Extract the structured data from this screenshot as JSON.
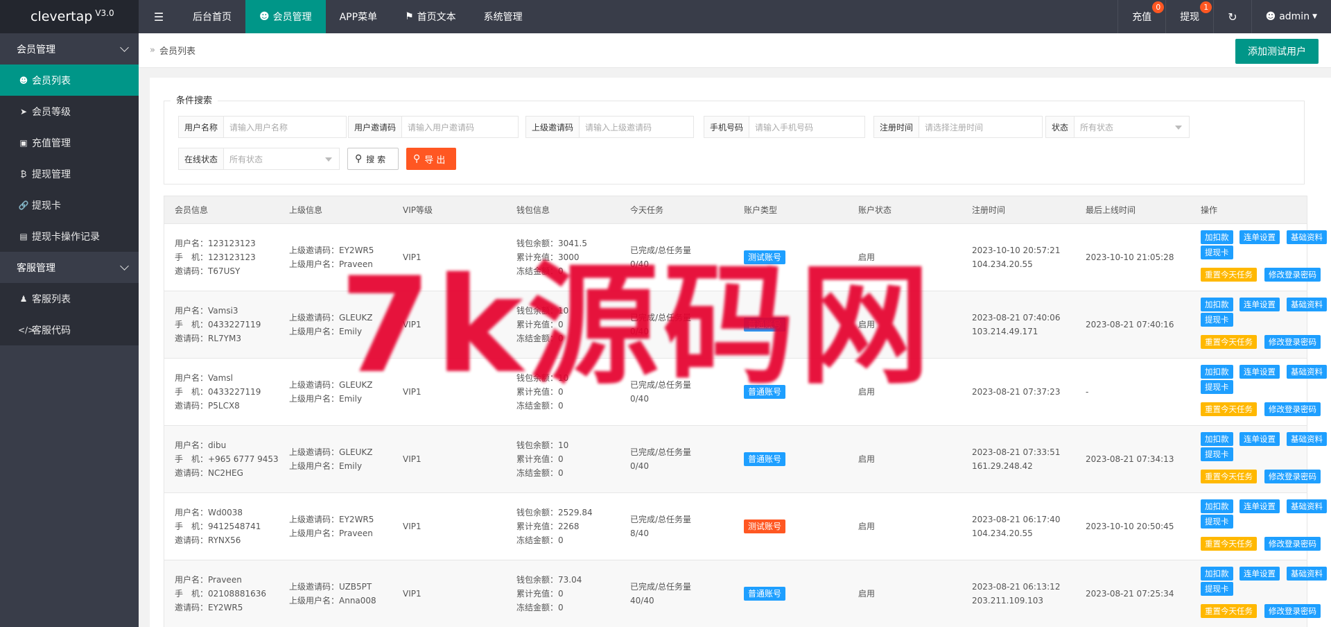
{
  "app": {
    "name": "clevertap",
    "version": "V3.0"
  },
  "topbar": {
    "tabs": [
      "后台首页",
      "会员管理",
      "APP菜单",
      "首页文本",
      "系统管理"
    ],
    "recharge_label": "充值",
    "recharge_badge": "0",
    "withdraw_label": "提现",
    "withdraw_badge": "1",
    "user": "admin"
  },
  "sidebar": {
    "group1": "会员管理",
    "items1": [
      "会员列表",
      "会员等级",
      "充值管理",
      "提现管理",
      "提现卡",
      "提现卡操作记录"
    ],
    "group2": "客服管理",
    "items2": [
      "客服列表",
      "客服代码"
    ]
  },
  "breadcrumb": {
    "current": "会员列表",
    "add_button": "添加测试用户"
  },
  "search": {
    "legend": "条件搜索",
    "username_label": "用户名称",
    "username_ph": "请输入用户名称",
    "invite_label": "用户邀请码",
    "invite_ph": "请输入用户邀请码",
    "parent_label": "上级邀请码",
    "parent_ph": "请输入上级邀请码",
    "phone_label": "手机号码",
    "phone_ph": "请输入手机号码",
    "regtime_label": "注册时间",
    "regtime_ph": "请选择注册时间",
    "status_label": "状态",
    "status_value": "所有状态",
    "online_label": "在线状态",
    "online_value": "所有状态",
    "search_btn": "搜 索",
    "export_btn": "导 出"
  },
  "table": {
    "headers": [
      "会员信息",
      "上级信息",
      "VIP等级",
      "钱包信息",
      "今天任务",
      "账户类型",
      "账户状态",
      "注册时间",
      "最后上线时间",
      "操作"
    ],
    "labels": {
      "username": "用户名：",
      "phone": "手　机：",
      "invite": "邀请码：",
      "parent_invite": "上级邀请码：",
      "parent_user": "上级用户名：",
      "balance": "钱包余额：",
      "recharge": "累计充值：",
      "frozen": "冻结金额：",
      "task": "已完成/总任务量"
    },
    "ops": [
      "加扣款",
      "连单设置",
      "基础资料",
      "提现卡",
      "重置今天任务",
      "修改登录密码"
    ],
    "rows": [
      {
        "user": "123123123",
        "phone": "123123123",
        "invite": "T67USY",
        "pinvite": "EY2WR5",
        "puser": "Praveen",
        "vip": "VIP1",
        "balance": "3041.5",
        "recharge": "3000",
        "frozen": "0",
        "task": "0/40",
        "type": "测试账号",
        "type_color": "blue",
        "status": "启用",
        "reg": "2023-10-10 20:57:21",
        "ip": "104.234.20.55",
        "last": "2023-10-10 21:05:28"
      },
      {
        "user": "Vamsi3",
        "phone": "0433227119",
        "invite": "RL7YM3",
        "pinvite": "GLEUKZ",
        "puser": "Emily",
        "vip": "VIP1",
        "balance": "10",
        "recharge": "0",
        "frozen": "0",
        "task": "0/40",
        "type": "普通账号",
        "type_color": "blue",
        "status": "启用",
        "reg": "2023-08-21 07:40:06",
        "ip": "103.214.49.171",
        "last": "2023-08-21 07:40:16"
      },
      {
        "user": "Vamsl",
        "phone": "0433227119",
        "invite": "P5LCX8",
        "pinvite": "GLEUKZ",
        "puser": "Emily",
        "vip": "VIP1",
        "balance": "10",
        "recharge": "0",
        "frozen": "0",
        "task": "0/40",
        "type": "普通账号",
        "type_color": "blue",
        "status": "启用",
        "reg": "2023-08-21 07:37:23",
        "ip": "",
        "last": "-"
      },
      {
        "user": "dibu",
        "phone": "+965 6777 9453",
        "invite": "NC2HEG",
        "pinvite": "GLEUKZ",
        "puser": "Emily",
        "vip": "VIP1",
        "balance": "10",
        "recharge": "0",
        "frozen": "0",
        "task": "0/40",
        "type": "普通账号",
        "type_color": "blue",
        "status": "启用",
        "reg": "2023-08-21 07:33:51",
        "ip": "161.29.248.42",
        "last": "2023-08-21 07:34:13"
      },
      {
        "user": "Wd0038",
        "phone": "9412548741",
        "invite": "RYNX56",
        "pinvite": "EY2WR5",
        "puser": "Praveen",
        "vip": "VIP1",
        "balance": "2529.84",
        "recharge": "2268",
        "frozen": "0",
        "task": "8/40",
        "type": "测试账号",
        "type_color": "red",
        "status": "启用",
        "reg": "2023-08-21 06:17:40",
        "ip": "104.234.20.55",
        "last": "2023-10-10 20:50:45"
      },
      {
        "user": "Praveen",
        "phone": "02108881636",
        "invite": "EY2WR5",
        "pinvite": "UZB5PT",
        "puser": "Anna008",
        "vip": "VIP1",
        "balance": "73.04",
        "recharge": "0",
        "frozen": "0",
        "task": "40/40",
        "type": "普通账号",
        "type_color": "blue",
        "status": "启用",
        "reg": "2023-08-21 06:13:12",
        "ip": "203.211.109.103",
        "last": "2023-08-21 07:25:34"
      }
    ]
  },
  "watermark": "7k源码网",
  "colors": {
    "primary": "#009688",
    "dark": "#393d49",
    "orange": "#ff5722",
    "blue": "#1e9fff",
    "yellow": "#ffb800"
  }
}
